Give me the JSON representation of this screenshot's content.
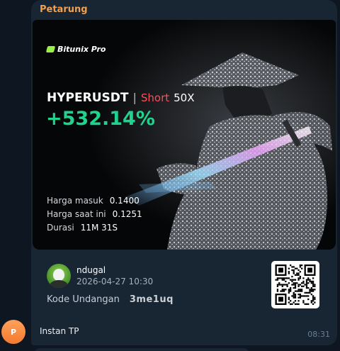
{
  "message": {
    "sender_name": "Petarung",
    "sender_avatar_letter": "P",
    "caption": "Instan TP",
    "time": "08:31"
  },
  "card": {
    "brand": "Bitunix Pro",
    "pair": "HYPERUSDT",
    "separator": "|",
    "side": "Short",
    "leverage": "50X",
    "pnl": "+532.14%",
    "stats": [
      {
        "label": "Harga masuk",
        "value": "0.1400"
      },
      {
        "label": "Harga saat ini",
        "value": "0.1251"
      },
      {
        "label": "Durasi",
        "value": "11M 31S"
      }
    ]
  },
  "referral": {
    "username": "ndugal",
    "date": "2026-04-27 10:30",
    "code_label": "Kode Undangan",
    "code_value": "3me1uq"
  },
  "colors": {
    "background": "#0e1621",
    "bubble": "#182533",
    "sender_name": "#f0a050",
    "short": "#ff4d5a",
    "pnl": "#1fd38e",
    "brand_mark": "#9af04a"
  },
  "icons": {
    "brand": "bitunix-logo-icon",
    "qr": "qr-code-icon",
    "avatar": "user-avatar-icon"
  }
}
